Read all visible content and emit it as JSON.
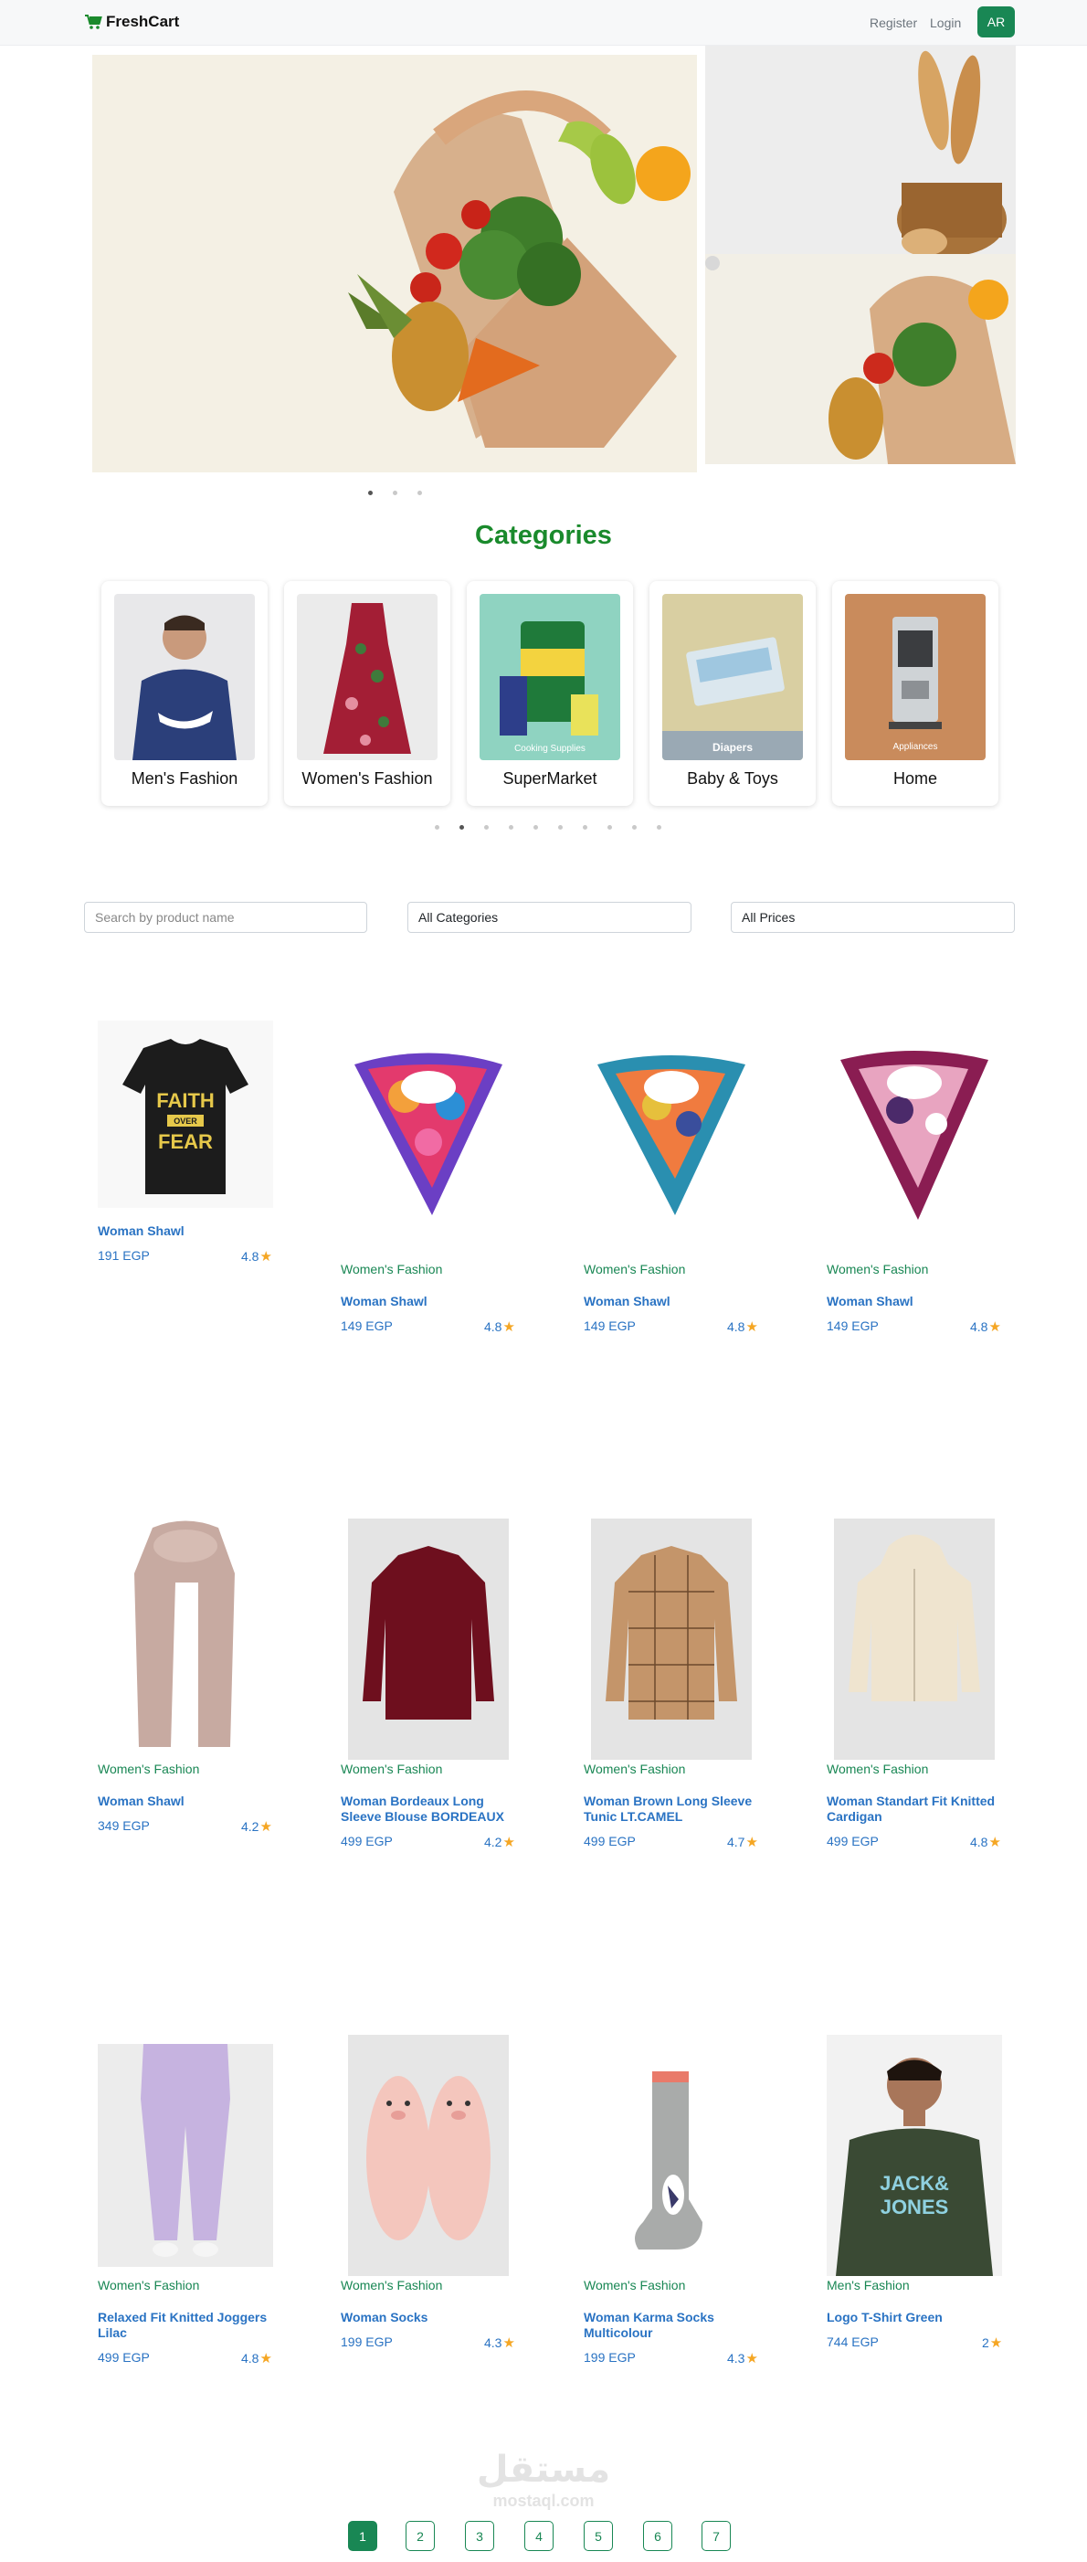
{
  "navbar": {
    "brand": "FreshCart",
    "register": "Register",
    "login": "Login",
    "lang_button": "AR"
  },
  "categories_section": {
    "title": "Categories",
    "items": [
      {
        "name": "Men's Fashion"
      },
      {
        "name": "Women's Fashion"
      },
      {
        "name": "SuperMarket",
        "image_caption": "Cooking Supplies"
      },
      {
        "name": "Baby & Toys",
        "image_caption": "Diapers"
      },
      {
        "name": "Home",
        "image_caption": "Appliances"
      }
    ]
  },
  "filters": {
    "search_placeholder": "Search by product name",
    "category_selected": "All Categories",
    "price_selected": "All Prices"
  },
  "products": [
    {
      "category": "",
      "title": "Woman Shawl",
      "price": "191 EGP",
      "rating": "4.8",
      "tshirt_text": [
        "FAITH",
        "OVER",
        "FEAR"
      ]
    },
    {
      "category": "Women's Fashion",
      "title": "Woman Shawl",
      "price": "149 EGP",
      "rating": "4.8"
    },
    {
      "category": "Women's Fashion",
      "title": "Woman Shawl",
      "price": "149 EGP",
      "rating": "4.8"
    },
    {
      "category": "Women's Fashion",
      "title": "Woman Shawl",
      "price": "149 EGP",
      "rating": "4.8"
    },
    {
      "category": "Women's Fashion",
      "title": "Woman Shawl",
      "price": "349 EGP",
      "rating": "4.2"
    },
    {
      "category": "Women's Fashion",
      "title": "Woman Bordeaux Long Sleeve Blouse BORDEAUX",
      "price": "499 EGP",
      "rating": "4.2"
    },
    {
      "category": "Women's Fashion",
      "title": "Woman Brown Long Sleeve Tunic LT.CAMEL",
      "price": "499 EGP",
      "rating": "4.7"
    },
    {
      "category": "Women's Fashion",
      "title": "Woman Standart Fit Knitted Cardigan",
      "price": "499 EGP",
      "rating": "4.8"
    },
    {
      "category": "Women's Fashion",
      "title": "Relaxed Fit Knitted Joggers Lilac",
      "price": "499 EGP",
      "rating": "4.8"
    },
    {
      "category": "Women's Fashion",
      "title": "Woman Socks",
      "price": "199 EGP",
      "rating": "4.3"
    },
    {
      "category": "Women's Fashion",
      "title": "Woman Karma Socks Multicolour",
      "price": "199 EGP",
      "rating": "4.3"
    },
    {
      "category": "Men's Fashion",
      "title": "Logo T-Shirt Green",
      "price": "744 EGP",
      "rating": "2",
      "tshirt_text": [
        "JACK&",
        "JONES"
      ]
    }
  ],
  "pagination": [
    "1",
    "2",
    "3",
    "4",
    "5",
    "6",
    "7"
  ],
  "watermark": {
    "arabic": "مستقل",
    "latin": "mostaql.com"
  },
  "colors": {
    "accent": "#198754",
    "title_green": "#1a8a2c",
    "link_blue": "#2a73c3",
    "star": "#f5a623"
  }
}
